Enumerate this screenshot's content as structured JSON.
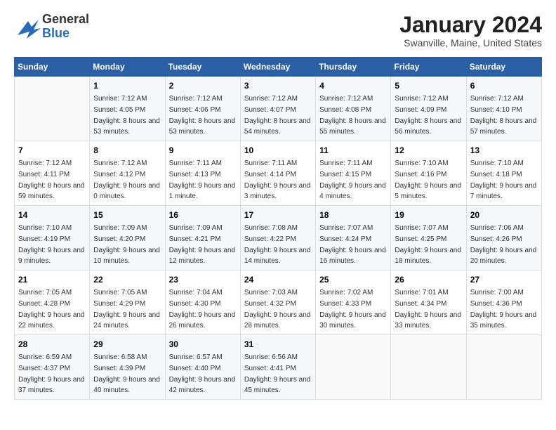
{
  "header": {
    "logo_general": "General",
    "logo_blue": "Blue",
    "month_title": "January 2024",
    "location": "Swanville, Maine, United States"
  },
  "columns": [
    "Sunday",
    "Monday",
    "Tuesday",
    "Wednesday",
    "Thursday",
    "Friday",
    "Saturday"
  ],
  "weeks": [
    [
      {
        "day": "",
        "sunrise": "",
        "sunset": "",
        "daylight": ""
      },
      {
        "day": "1",
        "sunrise": "Sunrise: 7:12 AM",
        "sunset": "Sunset: 4:05 PM",
        "daylight": "Daylight: 8 hours and 53 minutes."
      },
      {
        "day": "2",
        "sunrise": "Sunrise: 7:12 AM",
        "sunset": "Sunset: 4:06 PM",
        "daylight": "Daylight: 8 hours and 53 minutes."
      },
      {
        "day": "3",
        "sunrise": "Sunrise: 7:12 AM",
        "sunset": "Sunset: 4:07 PM",
        "daylight": "Daylight: 8 hours and 54 minutes."
      },
      {
        "day": "4",
        "sunrise": "Sunrise: 7:12 AM",
        "sunset": "Sunset: 4:08 PM",
        "daylight": "Daylight: 8 hours and 55 minutes."
      },
      {
        "day": "5",
        "sunrise": "Sunrise: 7:12 AM",
        "sunset": "Sunset: 4:09 PM",
        "daylight": "Daylight: 8 hours and 56 minutes."
      },
      {
        "day": "6",
        "sunrise": "Sunrise: 7:12 AM",
        "sunset": "Sunset: 4:10 PM",
        "daylight": "Daylight: 8 hours and 57 minutes."
      }
    ],
    [
      {
        "day": "7",
        "sunrise": "Sunrise: 7:12 AM",
        "sunset": "Sunset: 4:11 PM",
        "daylight": "Daylight: 8 hours and 59 minutes."
      },
      {
        "day": "8",
        "sunrise": "Sunrise: 7:12 AM",
        "sunset": "Sunset: 4:12 PM",
        "daylight": "Daylight: 9 hours and 0 minutes."
      },
      {
        "day": "9",
        "sunrise": "Sunrise: 7:11 AM",
        "sunset": "Sunset: 4:13 PM",
        "daylight": "Daylight: 9 hours and 1 minute."
      },
      {
        "day": "10",
        "sunrise": "Sunrise: 7:11 AM",
        "sunset": "Sunset: 4:14 PM",
        "daylight": "Daylight: 9 hours and 3 minutes."
      },
      {
        "day": "11",
        "sunrise": "Sunrise: 7:11 AM",
        "sunset": "Sunset: 4:15 PM",
        "daylight": "Daylight: 9 hours and 4 minutes."
      },
      {
        "day": "12",
        "sunrise": "Sunrise: 7:10 AM",
        "sunset": "Sunset: 4:16 PM",
        "daylight": "Daylight: 9 hours and 5 minutes."
      },
      {
        "day": "13",
        "sunrise": "Sunrise: 7:10 AM",
        "sunset": "Sunset: 4:18 PM",
        "daylight": "Daylight: 9 hours and 7 minutes."
      }
    ],
    [
      {
        "day": "14",
        "sunrise": "Sunrise: 7:10 AM",
        "sunset": "Sunset: 4:19 PM",
        "daylight": "Daylight: 9 hours and 9 minutes."
      },
      {
        "day": "15",
        "sunrise": "Sunrise: 7:09 AM",
        "sunset": "Sunset: 4:20 PM",
        "daylight": "Daylight: 9 hours and 10 minutes."
      },
      {
        "day": "16",
        "sunrise": "Sunrise: 7:09 AM",
        "sunset": "Sunset: 4:21 PM",
        "daylight": "Daylight: 9 hours and 12 minutes."
      },
      {
        "day": "17",
        "sunrise": "Sunrise: 7:08 AM",
        "sunset": "Sunset: 4:22 PM",
        "daylight": "Daylight: 9 hours and 14 minutes."
      },
      {
        "day": "18",
        "sunrise": "Sunrise: 7:07 AM",
        "sunset": "Sunset: 4:24 PM",
        "daylight": "Daylight: 9 hours and 16 minutes."
      },
      {
        "day": "19",
        "sunrise": "Sunrise: 7:07 AM",
        "sunset": "Sunset: 4:25 PM",
        "daylight": "Daylight: 9 hours and 18 minutes."
      },
      {
        "day": "20",
        "sunrise": "Sunrise: 7:06 AM",
        "sunset": "Sunset: 4:26 PM",
        "daylight": "Daylight: 9 hours and 20 minutes."
      }
    ],
    [
      {
        "day": "21",
        "sunrise": "Sunrise: 7:05 AM",
        "sunset": "Sunset: 4:28 PM",
        "daylight": "Daylight: 9 hours and 22 minutes."
      },
      {
        "day": "22",
        "sunrise": "Sunrise: 7:05 AM",
        "sunset": "Sunset: 4:29 PM",
        "daylight": "Daylight: 9 hours and 24 minutes."
      },
      {
        "day": "23",
        "sunrise": "Sunrise: 7:04 AM",
        "sunset": "Sunset: 4:30 PM",
        "daylight": "Daylight: 9 hours and 26 minutes."
      },
      {
        "day": "24",
        "sunrise": "Sunrise: 7:03 AM",
        "sunset": "Sunset: 4:32 PM",
        "daylight": "Daylight: 9 hours and 28 minutes."
      },
      {
        "day": "25",
        "sunrise": "Sunrise: 7:02 AM",
        "sunset": "Sunset: 4:33 PM",
        "daylight": "Daylight: 9 hours and 30 minutes."
      },
      {
        "day": "26",
        "sunrise": "Sunrise: 7:01 AM",
        "sunset": "Sunset: 4:34 PM",
        "daylight": "Daylight: 9 hours and 33 minutes."
      },
      {
        "day": "27",
        "sunrise": "Sunrise: 7:00 AM",
        "sunset": "Sunset: 4:36 PM",
        "daylight": "Daylight: 9 hours and 35 minutes."
      }
    ],
    [
      {
        "day": "28",
        "sunrise": "Sunrise: 6:59 AM",
        "sunset": "Sunset: 4:37 PM",
        "daylight": "Daylight: 9 hours and 37 minutes."
      },
      {
        "day": "29",
        "sunrise": "Sunrise: 6:58 AM",
        "sunset": "Sunset: 4:39 PM",
        "daylight": "Daylight: 9 hours and 40 minutes."
      },
      {
        "day": "30",
        "sunrise": "Sunrise: 6:57 AM",
        "sunset": "Sunset: 4:40 PM",
        "daylight": "Daylight: 9 hours and 42 minutes."
      },
      {
        "day": "31",
        "sunrise": "Sunrise: 6:56 AM",
        "sunset": "Sunset: 4:41 PM",
        "daylight": "Daylight: 9 hours and 45 minutes."
      },
      {
        "day": "",
        "sunrise": "",
        "sunset": "",
        "daylight": ""
      },
      {
        "day": "",
        "sunrise": "",
        "sunset": "",
        "daylight": ""
      },
      {
        "day": "",
        "sunrise": "",
        "sunset": "",
        "daylight": ""
      }
    ]
  ]
}
